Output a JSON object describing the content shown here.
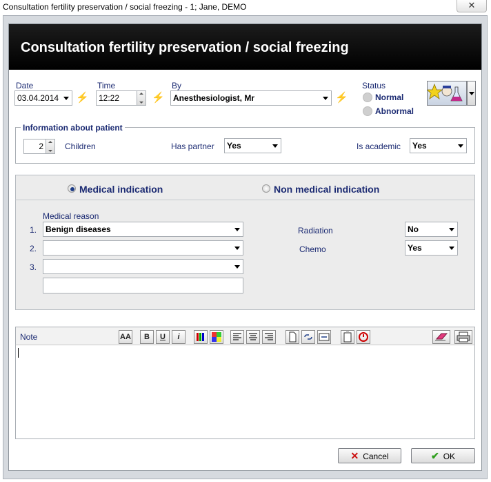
{
  "window": {
    "title": "Consultation fertility preservation / social freezing - 1; Jane, DEMO",
    "close_glyph": "✕"
  },
  "header": {
    "title": "Consultation fertility preservation / social freezing"
  },
  "fields": {
    "date": {
      "label": "Date",
      "value": "03.04.2014"
    },
    "time": {
      "label": "Time",
      "value": "12:22"
    },
    "by": {
      "label": "By",
      "value": "Anesthesiologist, Mr"
    },
    "status": {
      "label": "Status",
      "options": [
        "Normal",
        "Abnormal"
      ]
    }
  },
  "patient_info": {
    "label": "Information about patient",
    "children": {
      "value": "2",
      "label": "Children"
    },
    "has_partner": {
      "label": "Has partner",
      "value": "Yes"
    },
    "is_academic": {
      "label": "Is academic",
      "value": "Yes"
    }
  },
  "indication": {
    "medical": {
      "label": "Medical indication",
      "selected": true
    },
    "non_medical": {
      "label": "Non medical indication",
      "selected": false
    },
    "medical_reason": {
      "label": "Medical reason",
      "rows": [
        {
          "num": "1.",
          "value": "Benign diseases"
        },
        {
          "num": "2.",
          "value": ""
        },
        {
          "num": "3.",
          "value": ""
        }
      ]
    },
    "radiation": {
      "label": "Radiation",
      "value": "No"
    },
    "chemo": {
      "label": "Chemo",
      "value": "Yes"
    }
  },
  "note": {
    "label": "Note",
    "toolbar": {
      "font": "AA",
      "bold": "B",
      "underline": "U",
      "italic": "i"
    },
    "text": ""
  },
  "buttons": {
    "cancel": "Cancel",
    "ok": "OK"
  },
  "colors": {
    "header_bg": "#000000",
    "label": "#1b2a72",
    "cancel_icon": "#cc1111",
    "ok_icon": "#2e9e1c"
  }
}
